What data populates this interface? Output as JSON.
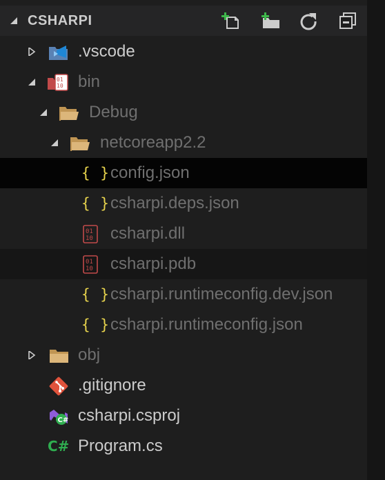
{
  "explorer": {
    "root_title": "CSHARPI",
    "actions": [
      {
        "name": "new-file",
        "icon": "new-file-icon"
      },
      {
        "name": "new-folder",
        "icon": "new-folder-icon"
      },
      {
        "name": "refresh",
        "icon": "refresh-icon"
      },
      {
        "name": "collapse-all",
        "icon": "collapse-all-icon"
      }
    ],
    "items": [
      {
        "label": ".vscode",
        "icon": "vscode-folder-icon",
        "expanded": false
      },
      {
        "label": "bin",
        "icon": "binary-folder-icon",
        "expanded": true,
        "dimmed": true
      },
      {
        "label": "Debug",
        "icon": "folder-open-icon",
        "expanded": true,
        "dimmed": true
      },
      {
        "label": "netcoreapp2.2",
        "icon": "folder-open-icon",
        "expanded": true,
        "dimmed": true
      },
      {
        "label": "config.json",
        "icon": "json-icon",
        "dimmed": true,
        "focused": true
      },
      {
        "label": "csharpi.deps.json",
        "icon": "json-icon",
        "dimmed": true
      },
      {
        "label": "csharpi.dll",
        "icon": "binary-file-icon",
        "dimmed": true
      },
      {
        "label": "csharpi.pdb",
        "icon": "binary-file-icon",
        "dimmed": true,
        "hover": true
      },
      {
        "label": "csharpi.runtimeconfig.dev.json",
        "icon": "json-icon",
        "dimmed": true
      },
      {
        "label": "csharpi.runtimeconfig.json",
        "icon": "json-icon",
        "dimmed": true
      },
      {
        "label": "obj",
        "icon": "folder-icon",
        "expanded": false,
        "dimmed": true
      },
      {
        "label": ".gitignore",
        "icon": "git-icon"
      },
      {
        "label": "csharpi.csproj",
        "icon": "csproj-icon"
      },
      {
        "label": "Program.cs",
        "icon": "csharp-icon"
      }
    ],
    "colors": {
      "background": "#1e1e1e",
      "header": "#252526",
      "text": "#cccccc",
      "dimmed_text": "#6f6f6f",
      "json_icon": "#e8d44d",
      "binary_icon": "#c24a4a",
      "folder": "#c09553",
      "git": "#e0533c",
      "csharp": "#2fae50"
    }
  }
}
